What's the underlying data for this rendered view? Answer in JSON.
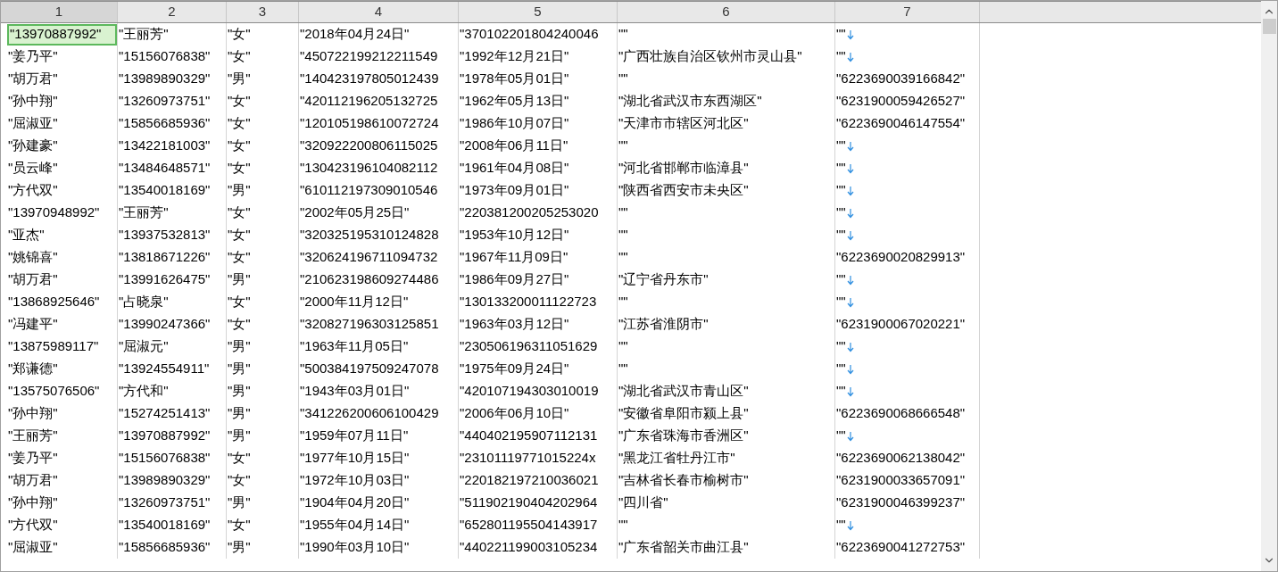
{
  "columns": [
    {
      "label": "1",
      "selected": true
    },
    {
      "label": "2",
      "selected": false
    },
    {
      "label": "3",
      "selected": false
    },
    {
      "label": "4",
      "selected": false
    },
    {
      "label": "5",
      "selected": false
    },
    {
      "label": "6",
      "selected": false
    },
    {
      "label": "7",
      "selected": false
    }
  ],
  "rows": [
    {
      "selected": true,
      "line_break": true,
      "cells": [
        "\"13970887992\"",
        "\"王丽芳\"",
        "\"女\"",
        "\"2018年04月24日\"",
        "\"370102201804240046",
        "\"\"",
        "\"\""
      ]
    },
    {
      "selected": false,
      "line_break": true,
      "cells": [
        "\"姜乃平\"",
        "\"15156076838\"",
        "\"女\"",
        "\"450722199212211549",
        "\"1992年12月21日\"",
        "\"广西壮族自治区钦州市灵山县\"",
        "\"\""
      ]
    },
    {
      "selected": false,
      "line_break": false,
      "cells": [
        "\"胡万君\"",
        "\"13989890329\"",
        "\"男\"",
        "\"140423197805012439",
        "\"1978年05月01日\"",
        "\"\"",
        "\"6223690039166842\""
      ]
    },
    {
      "selected": false,
      "line_break": false,
      "cells": [
        "\"孙中翔\"",
        "\"13260973751\"",
        "\"女\"",
        "\"420112196205132725",
        "\"1962年05月13日\"",
        "\"湖北省武汉市东西湖区\"",
        "\"6231900059426527\""
      ]
    },
    {
      "selected": false,
      "line_break": false,
      "cells": [
        "\"屈淑亚\"",
        "\"15856685936\"",
        "\"女\"",
        "\"120105198610072724",
        "\"1986年10月07日\"",
        "\"天津市市辖区河北区\"",
        "\"6223690046147554\""
      ]
    },
    {
      "selected": false,
      "line_break": true,
      "cells": [
        "\"孙建豪\"",
        "\"13422181003\"",
        "\"女\"",
        "\"320922200806115025",
        "\"2008年06月11日\"",
        "\"\"",
        "\"\""
      ]
    },
    {
      "selected": false,
      "line_break": true,
      "cells": [
        "\"员云峰\"",
        "\"13484648571\"",
        "\"女\"",
        "\"130423196104082112",
        "\"1961年04月08日\"",
        "\"河北省邯郸市临漳县\"",
        "\"\""
      ]
    },
    {
      "selected": false,
      "line_break": true,
      "cells": [
        "\"方代双\"",
        "\"13540018169\"",
        "\"男\"",
        "\"610112197309010546",
        "\"1973年09月01日\"",
        "\"陕西省西安市未央区\"",
        "\"\""
      ]
    },
    {
      "selected": false,
      "line_break": true,
      "cells": [
        "\"13970948992\"",
        "\"王丽芳\"",
        "\"女\"",
        "\"2002年05月25日\"",
        "\"220381200205253020",
        "\"\"",
        "\"\""
      ]
    },
    {
      "selected": false,
      "line_break": true,
      "cells": [
        "\"亚杰\"",
        "\"13937532813\"",
        "\"女\"",
        "\"320325195310124828",
        "\"1953年10月12日\"",
        "\"\"",
        "\"\""
      ]
    },
    {
      "selected": false,
      "line_break": false,
      "cells": [
        "\"姚锦喜\"",
        "\"13818671226\"",
        "\"女\"",
        "\"320624196711094732",
        "\"1967年11月09日\"",
        "\"\"",
        "\"6223690020829913\""
      ]
    },
    {
      "selected": false,
      "line_break": true,
      "cells": [
        "\"胡万君\"",
        "\"13991626475\"",
        "\"男\"",
        "\"210623198609274486",
        "\"1986年09月27日\"",
        "\"辽宁省丹东市\"",
        "\"\""
      ]
    },
    {
      "selected": false,
      "line_break": true,
      "cells": [
        "\"13868925646\"",
        "\"占晓泉\"",
        "\"女\"",
        "\"2000年11月12日\"",
        "\"130133200011122723",
        "\"\"",
        "\"\""
      ]
    },
    {
      "selected": false,
      "line_break": false,
      "cells": [
        "\"冯建平\"",
        "\"13990247366\"",
        "\"女\"",
        "\"320827196303125851",
        "\"1963年03月12日\"",
        "\"江苏省淮阴市\"",
        "\"6231900067020221\""
      ]
    },
    {
      "selected": false,
      "line_break": true,
      "cells": [
        "\"13875989117\"",
        "\"屈淑元\"",
        "\"男\"",
        "\"1963年11月05日\"",
        "\"230506196311051629",
        "\"\"",
        "\"\""
      ]
    },
    {
      "selected": false,
      "line_break": true,
      "cells": [
        "\"郑谦德\"",
        "\"13924554911\"",
        "\"男\"",
        "\"500384197509247078",
        "\"1975年09月24日\"",
        "\"\"",
        "\"\""
      ]
    },
    {
      "selected": false,
      "line_break": true,
      "cells": [
        "\"13575076506\"",
        "\"方代和\"",
        "\"男\"",
        "\"1943年03月01日\"",
        "\"420107194303010019",
        "\"湖北省武汉市青山区\"",
        "\"\""
      ]
    },
    {
      "selected": false,
      "line_break": false,
      "cells": [
        "\"孙中翔\"",
        "\"15274251413\"",
        "\"男\"",
        "\"341226200606100429",
        "\"2006年06月10日\"",
        "\"安徽省阜阳市颍上县\"",
        "\"6223690068666548\""
      ]
    },
    {
      "selected": false,
      "line_break": true,
      "cells": [
        "\"王丽芳\"",
        "\"13970887992\"",
        "\"男\"",
        "\"1959年07月11日\"",
        "\"440402195907112131",
        "\"广东省珠海市香洲区\"",
        "\"\""
      ]
    },
    {
      "selected": false,
      "line_break": false,
      "cells": [
        "\"姜乃平\"",
        "\"15156076838\"",
        "\"女\"",
        "\"1977年10月15日\"",
        "\"23101119771015224x",
        "\"黑龙江省牡丹江市\"",
        "\"6223690062138042\""
      ]
    },
    {
      "selected": false,
      "line_break": false,
      "cells": [
        "\"胡万君\"",
        "\"13989890329\"",
        "\"女\"",
        "\"1972年10月03日\"",
        "\"220182197210036021",
        "\"吉林省长春市榆树市\"",
        "\"6231900033657091\""
      ]
    },
    {
      "selected": false,
      "line_break": false,
      "cells": [
        "\"孙中翔\"",
        "\"13260973751\"",
        "\"男\"",
        "\"1904年04月20日\"",
        "\"511902190404202964",
        "\"四川省\"",
        "\"6231900046399237\""
      ]
    },
    {
      "selected": false,
      "line_break": true,
      "cells": [
        "\"方代双\"",
        "\"13540018169\"",
        "\"女\"",
        "\"1955年04月14日\"",
        "\"652801195504143917",
        "\"\"",
        "\"\""
      ]
    },
    {
      "selected": false,
      "line_break": false,
      "cells": [
        "\"屈淑亚\"",
        "\"15856685936\"",
        "\"男\"",
        "\"1990年03月10日\"",
        "\"440221199003105234",
        "\"广东省韶关市曲江县\"",
        "\"6223690041272753\""
      ]
    }
  ]
}
